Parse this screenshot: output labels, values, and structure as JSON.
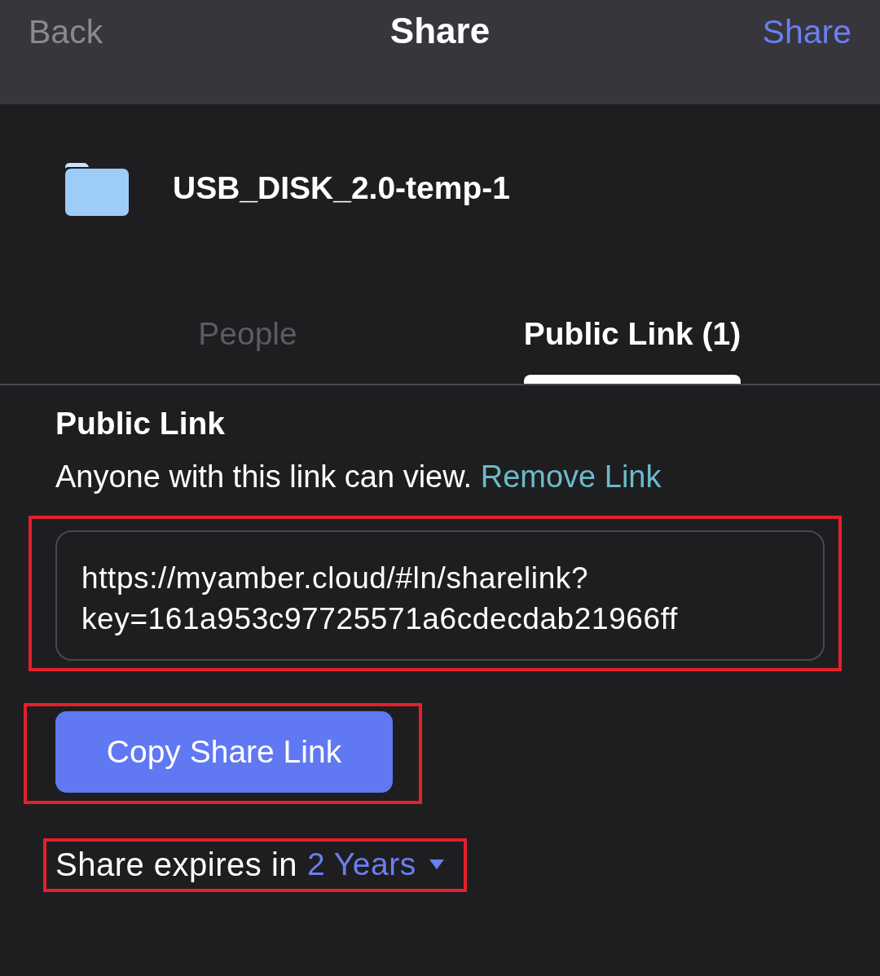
{
  "nav": {
    "back": "Back",
    "title": "Share",
    "action": "Share"
  },
  "item": {
    "name": "USB_DISK_2.0-temp-1"
  },
  "tabs": [
    {
      "label": "People",
      "selected": false
    },
    {
      "label": "Public Link (1)",
      "selected": true
    }
  ],
  "public_link": {
    "heading": "Public Link",
    "description": "Anyone with this link can view.",
    "remove_link": "Remove Link",
    "link_field": {
      "value": "https://myamber.cloud/#ln/sharelink?key=161a953c97725571a6cdecdab21966ff",
      "highlighted": true
    },
    "copy_button": {
      "label": "Copy Share Link",
      "highlighted": true
    },
    "expiry": {
      "label": "Share expires in",
      "value": "2 Years",
      "highlighted": true
    }
  }
}
